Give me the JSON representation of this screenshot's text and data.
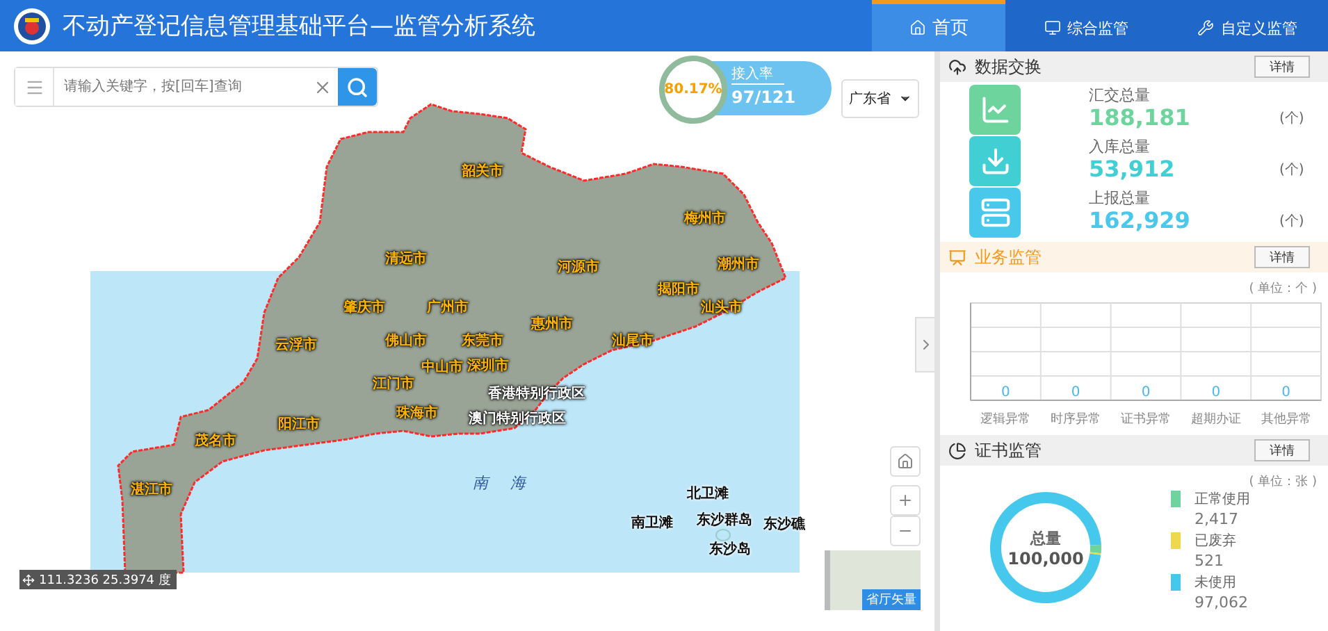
{
  "header": {
    "title": "不动产登记信息管理基础平台—监管分析系统",
    "nav": [
      {
        "label": "首页",
        "selected": true
      },
      {
        "label": "综合监管",
        "selected": false
      },
      {
        "label": "自定义监管",
        "selected": false
      }
    ]
  },
  "search": {
    "placeholder": "请输入关键字，按[回车]查询"
  },
  "access_rate": {
    "percent": "80.17%",
    "label": "接入率",
    "value": "97/121"
  },
  "region_select": {
    "value": "广东省"
  },
  "map": {
    "cities": [
      "韶关市",
      "梅州市",
      "清远市",
      "河源市",
      "潮州市",
      "揭阳市",
      "肇庆市",
      "广州市",
      "汕头市",
      "惠州市",
      "云浮市",
      "佛山市",
      "东莞市",
      "汕尾市",
      "中山市",
      "深圳市",
      "江门市",
      "珠海市",
      "阳江市",
      "茂名市",
      "湛江市"
    ],
    "regions": [
      "香港特别行政区",
      "澳门特别行政区"
    ],
    "sea": "南海",
    "islands": [
      "北卫滩",
      "南卫滩",
      "东沙群岛",
      "东沙礁",
      "东沙岛"
    ],
    "coordinates": "111.3236 25.3974 度",
    "basemap_label": "省厅矢量"
  },
  "data_exchange": {
    "title": "数据交换",
    "button": "详情",
    "items": [
      {
        "label": "汇交总量",
        "value": "188,181",
        "unit": "(个)",
        "color": "#6cd49c"
      },
      {
        "label": "入库总量",
        "value": "53,912",
        "unit": "(个)",
        "color": "#41cfd4"
      },
      {
        "label": "上报总量",
        "value": "162,929",
        "unit": "(个)",
        "color": "#4ac8ec"
      }
    ]
  },
  "business": {
    "title": "业务监管",
    "button": "详情",
    "unit": "( 单位：个 )",
    "columns": [
      {
        "label": "逻辑异常",
        "value": "0"
      },
      {
        "label": "时序异常",
        "value": "0"
      },
      {
        "label": "证书异常",
        "value": "0"
      },
      {
        "label": "超期办证",
        "value": "0"
      },
      {
        "label": "其他异常",
        "value": "0"
      }
    ]
  },
  "certificate": {
    "title": "证书监管",
    "button": "详情",
    "unit": "( 单位：张 )",
    "center_label": "总量",
    "center_value": "100,000",
    "chart_data": {
      "type": "donut",
      "categories": [
        "正常使用",
        "已废弃",
        "未使用"
      ],
      "values": [
        2.417,
        0.521,
        97.062
      ]
    },
    "legend": [
      {
        "value": "2,417",
        "color": "#6cd49c"
      },
      {
        "value": "521",
        "color": "#f0d84c"
      },
      {
        "value": "97,062",
        "color": "#45c8ec"
      }
    ]
  }
}
